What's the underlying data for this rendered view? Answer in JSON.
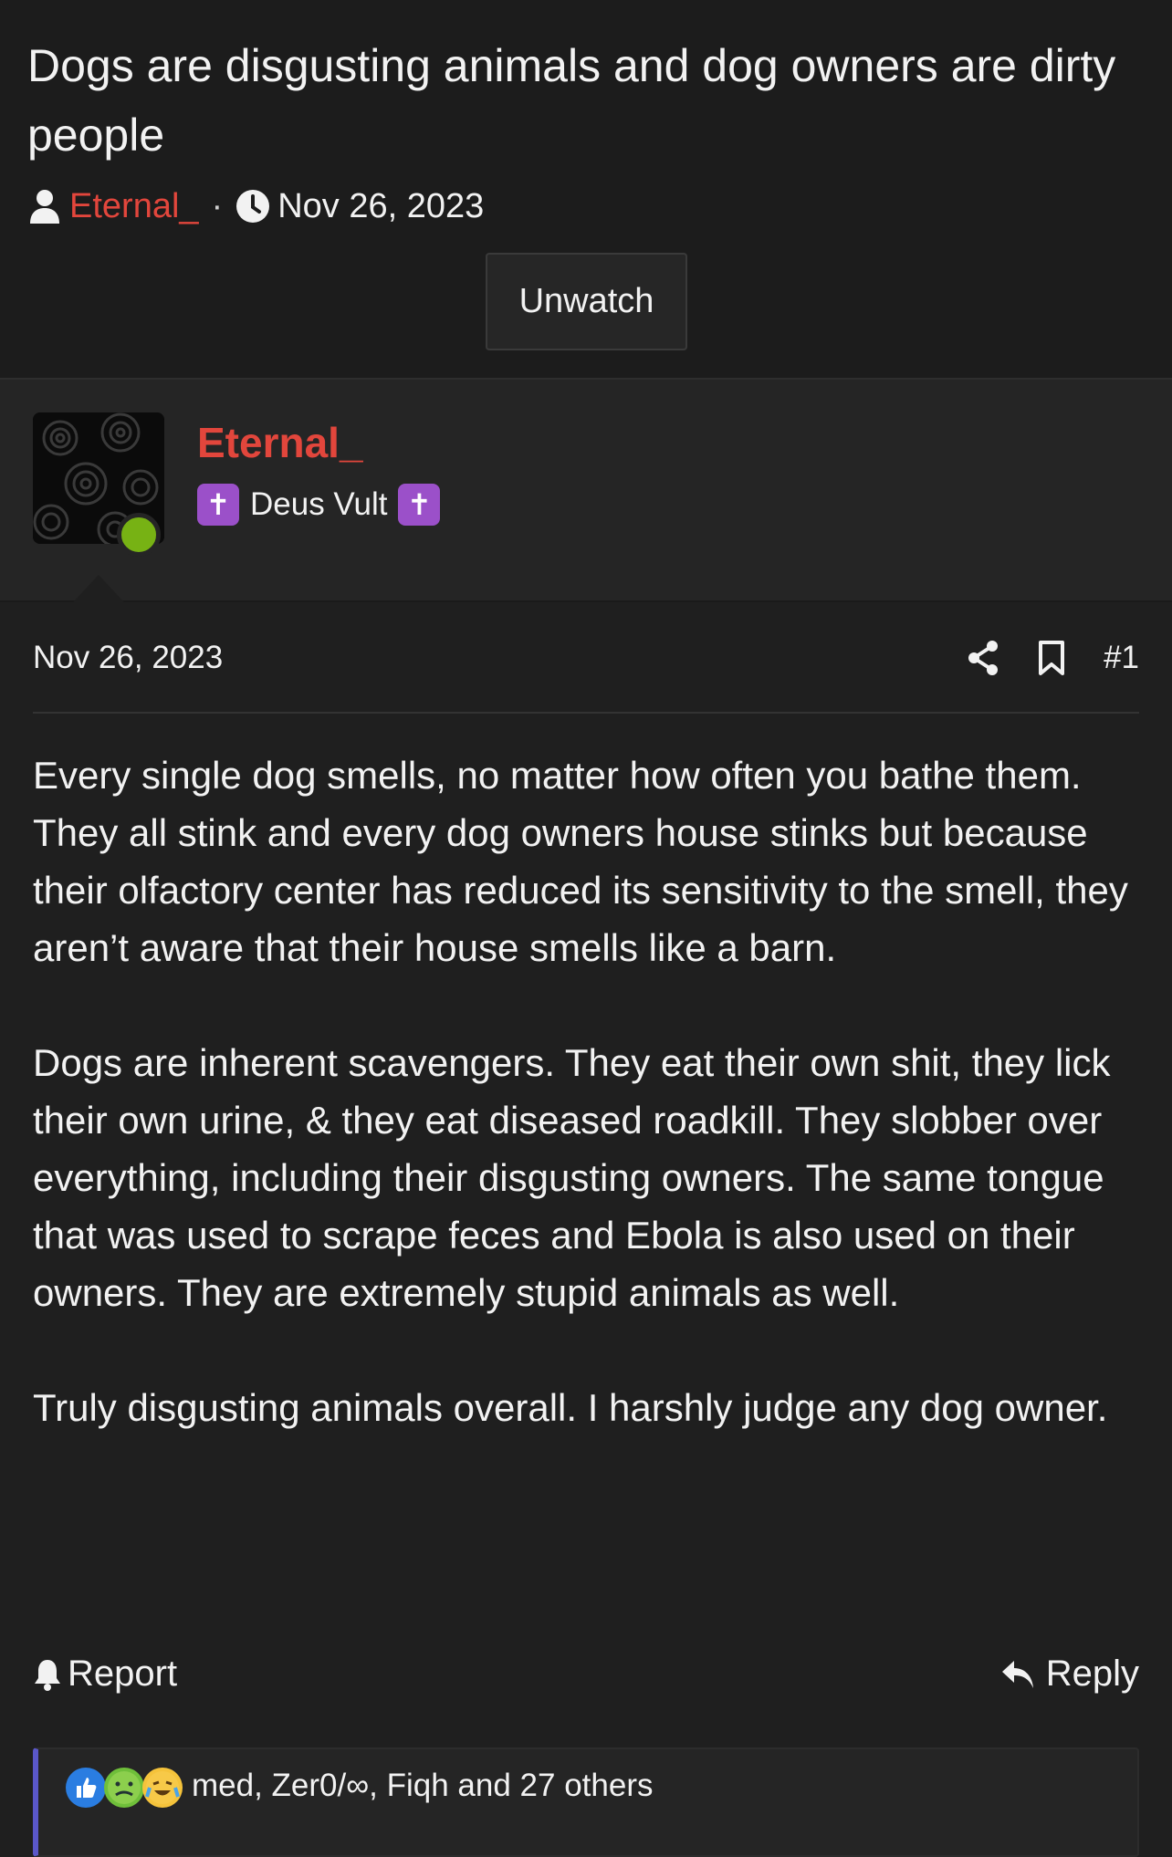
{
  "thread": {
    "title": "Dogs are disgusting animals and dog owners are dirty people",
    "author": "Eternal_",
    "separator": "·",
    "date": "Nov 26, 2023",
    "unwatch_label": "Unwatch"
  },
  "user": {
    "name": "Eternal_",
    "title_text": "Deus Vult",
    "badge_glyph": "✝",
    "online": true
  },
  "post": {
    "date": "Nov 26, 2023",
    "number": "#1",
    "paragraphs": [
      "Every single dog smells, no matter how often you bathe them. They all stink and every dog owners house stinks but because their olfactory center has reduced its sensitivity to the smell, they aren’t aware that their house smells like a barn.",
      "Dogs are inherent scavengers. They eat their own shit, they lick their own urine, & they eat diseased roadkill. They slobber over everything, including their disgusting owners. The same tongue that was used to scrape feces and Ebola is also used on their owners. They are extremely stupid animals as well.",
      "Truly disgusting animals overall. I harshly judge any dog owner."
    ],
    "report_label": "Report",
    "reply_label": "Reply"
  },
  "reactions": {
    "summary": "med, Zer0/∞, Fiqh and 27 others",
    "icons": [
      "like-icon",
      "nauseated-icon",
      "crying-laughing-icon"
    ]
  },
  "colors": {
    "accent_username": "#e2463c",
    "online": "#77b214",
    "badge": "#9b50c9",
    "reaction_bar": "#5a57c9"
  }
}
